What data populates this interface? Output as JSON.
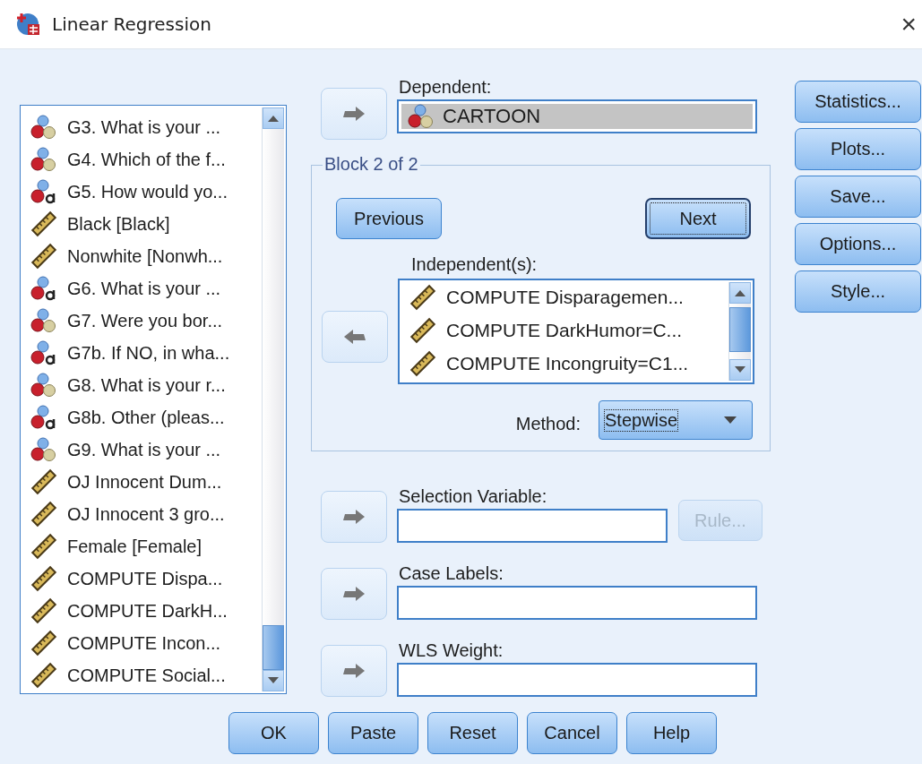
{
  "window": {
    "title": "Linear Regression",
    "close": "×"
  },
  "variables": [
    {
      "label": "G3. What is your ...",
      "kind": "nominal"
    },
    {
      "label": "G4. Which of the f...",
      "kind": "nominal"
    },
    {
      "label": "G5. How would yo...",
      "kind": "string"
    },
    {
      "label": "Black [Black]",
      "kind": "scale"
    },
    {
      "label": "Nonwhite [Nonwh...",
      "kind": "scale"
    },
    {
      "label": "G6. What is your ...",
      "kind": "string"
    },
    {
      "label": "G7. Were you bor...",
      "kind": "nominal"
    },
    {
      "label": "G7b. If NO, in wha...",
      "kind": "string"
    },
    {
      "label": "G8. What is your r...",
      "kind": "nominal"
    },
    {
      "label": "G8b. Other (pleas...",
      "kind": "string"
    },
    {
      "label": "G9. What is your ...",
      "kind": "nominal"
    },
    {
      "label": "OJ Innocent Dum...",
      "kind": "scale"
    },
    {
      "label": "OJ Innocent 3 gro...",
      "kind": "scale"
    },
    {
      "label": "Female [Female]",
      "kind": "scale"
    },
    {
      "label": "COMPUTE Dispa...",
      "kind": "scale"
    },
    {
      "label": "COMPUTE DarkH...",
      "kind": "scale"
    },
    {
      "label": "COMPUTE Incon...",
      "kind": "scale"
    },
    {
      "label": "COMPUTE Social...",
      "kind": "scale"
    }
  ],
  "dependent": {
    "label": "Dependent:",
    "arrow_left": false,
    "value": {
      "label": "CARTOON",
      "kind": "nominal"
    }
  },
  "block": {
    "title": "Block 2 of 2",
    "previous": {
      "label": "Previous",
      "focused": false
    },
    "next": {
      "label": "Next",
      "focused": true
    },
    "independents": {
      "label": "Independent(s):",
      "arrow_left": true,
      "items": [
        {
          "label": "COMPUTE Disparagemen...",
          "kind": "scale"
        },
        {
          "label": "COMPUTE DarkHumor=C...",
          "kind": "scale"
        },
        {
          "label": "COMPUTE Incongruity=C1...",
          "kind": "scale"
        }
      ]
    },
    "method": {
      "label": "Method:",
      "value": "Stepwise",
      "focused": true
    }
  },
  "selection": {
    "label": "Selection Variable:",
    "arrow_left": false,
    "rule": {
      "label": "Rule...",
      "disabled": true
    }
  },
  "case_labels": {
    "label": "Case Labels:",
    "arrow_left": false
  },
  "wls_weight": {
    "label": "WLS Weight:",
    "arrow_left": false
  },
  "side_buttons": [
    "Statistics...",
    "Plots...",
    "Save...",
    "Options...",
    "Style..."
  ],
  "footer_buttons": [
    "OK",
    "Paste",
    "Reset",
    "Cancel",
    "Help"
  ]
}
